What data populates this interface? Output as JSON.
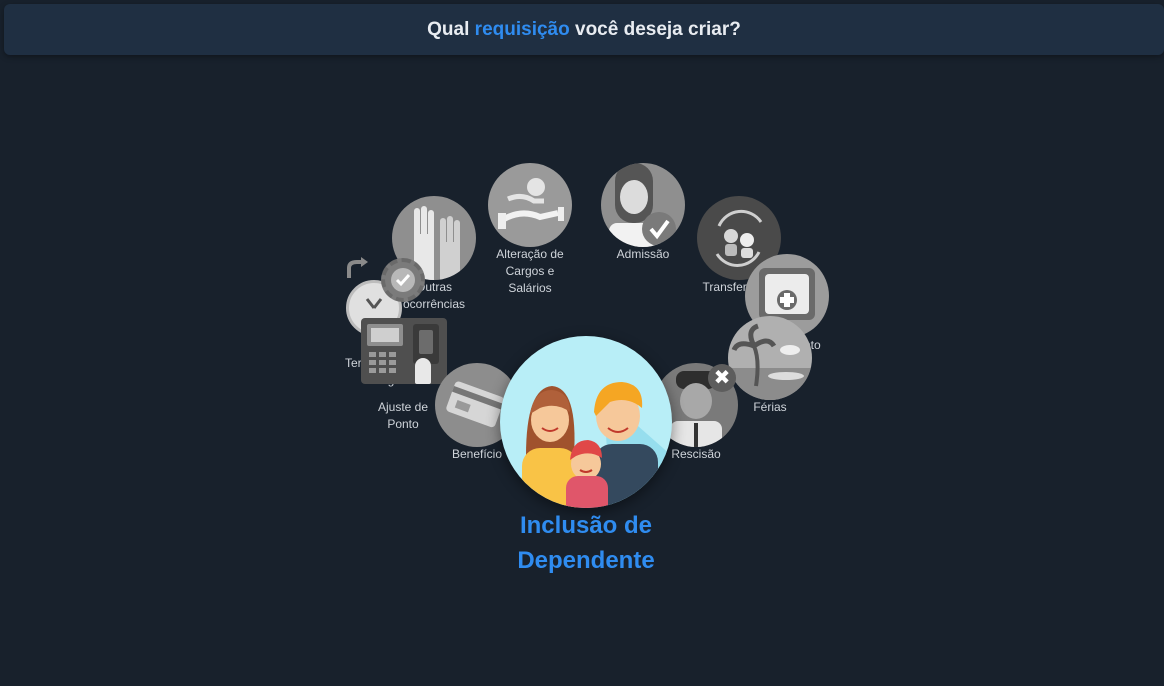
{
  "header": {
    "title_prefix": "Qual",
    "title_highlight": "requisição",
    "title_suffix": "você deseja criar?"
  },
  "options": {
    "alteracao": "Alteração de\nCargos e\nSalários",
    "admissao": "Admissão",
    "outras": "Outras\nocorrências",
    "transferencia": "Transferência",
    "afastamento": "Afastamento",
    "terminal": "Terminal de\nCargos",
    "ferias": "Férias",
    "ajuste": "Ajuste de\nPonto",
    "beneficio": "Benefício",
    "rescisao": "Rescisão"
  },
  "selected": {
    "label": "Inclusão de\nDependente"
  },
  "colors": {
    "background": "#18212c",
    "header": "#1f2f42",
    "accent": "#2f8cf0",
    "selected_circle": "#b8eef7"
  }
}
